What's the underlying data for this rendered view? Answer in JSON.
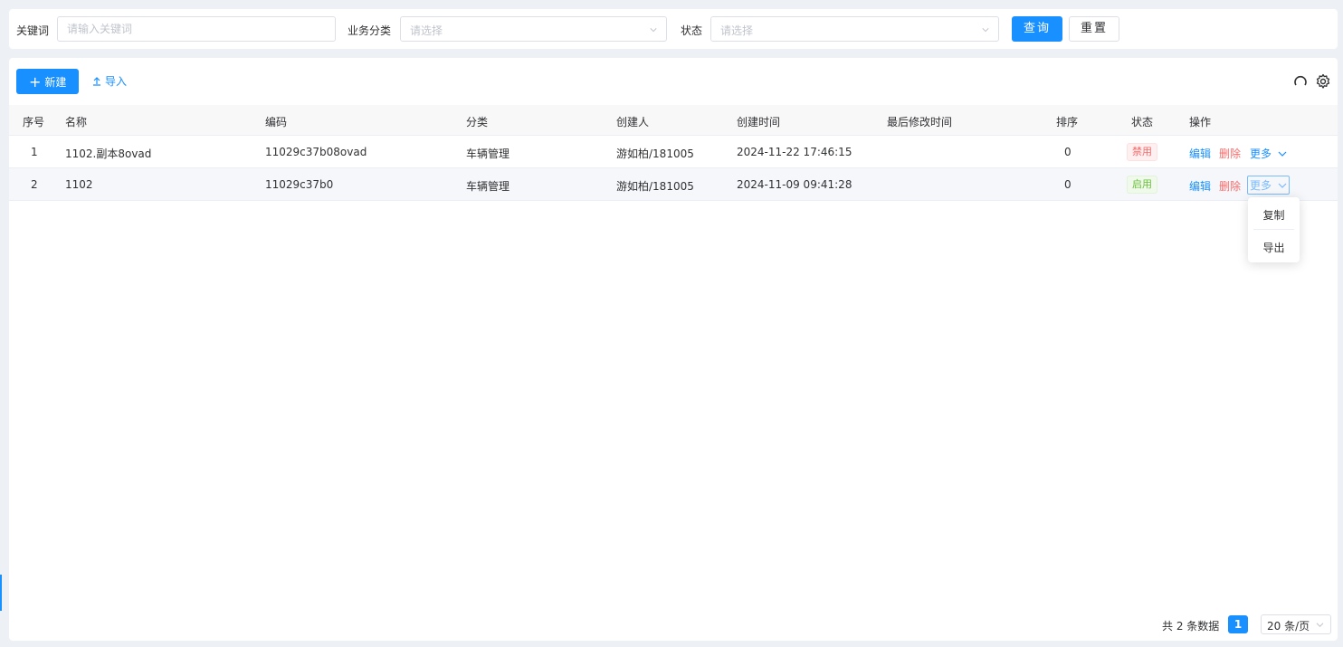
{
  "filters": {
    "keyword_label": "关键词",
    "keyword_placeholder": "请输入关键词",
    "category_label": "业务分类",
    "category_placeholder": "请选择",
    "status_label": "状态",
    "status_placeholder": "请选择",
    "query_button": "查询",
    "reset_button": "重置"
  },
  "toolbar": {
    "new_button": "新建",
    "import_button": "导入",
    "refresh_icon": "refresh-icon",
    "settings_icon": "gear-icon"
  },
  "table": {
    "headers": [
      "序号",
      "名称",
      "编码",
      "分类",
      "创建人",
      "创建时间",
      "最后修改时间",
      "排序",
      "状态",
      "操作"
    ],
    "rows": [
      {
        "index": "1",
        "name": "1102.副本8ovad",
        "code": "11029c37b08ovad",
        "category": "车辆管理",
        "creator": "游如柏/181005",
        "created": "2024-11-22 17:46:15",
        "modified": "",
        "sort": "0",
        "status": "禁用"
      },
      {
        "index": "2",
        "name": "1102",
        "code": "11029c37b0",
        "category": "车辆管理",
        "creator": "游如柏/181005",
        "created": "2024-11-09 09:41:28",
        "modified": "",
        "sort": "0",
        "status": "启用"
      }
    ],
    "actions": {
      "edit": "编辑",
      "delete": "删除",
      "more": "更多"
    }
  },
  "more_menu": {
    "items": [
      "复制",
      "导出"
    ]
  },
  "pagination": {
    "total_text": "共 2 条数据",
    "current_page": "1",
    "page_size": "20 条/页"
  },
  "colors": {
    "primary": "#1890ff",
    "danger": "#f56c6c",
    "success": "#67c23a"
  }
}
